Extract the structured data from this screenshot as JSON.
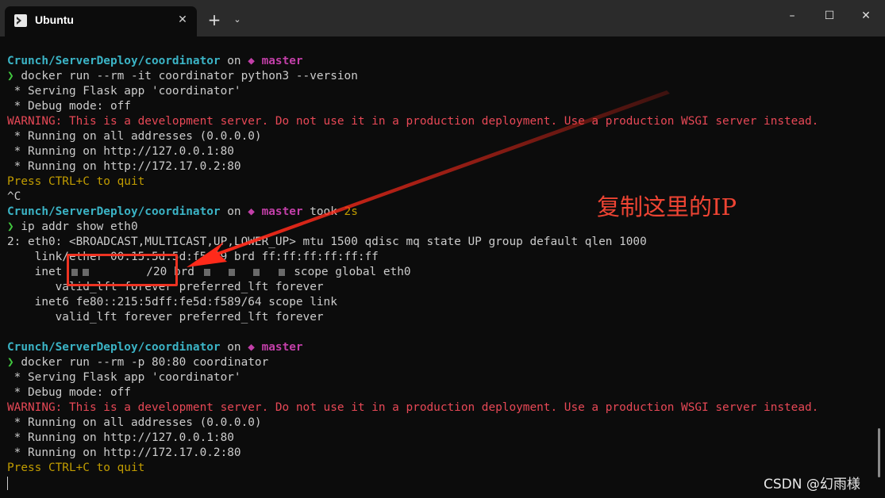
{
  "window": {
    "tab_title": "Ubuntu",
    "tab_close": "✕",
    "new_tab": "+",
    "tab_dropdown": "⌄",
    "minimize": "–",
    "maximize": "☐",
    "close": "✕"
  },
  "terminal": {
    "lines": [
      [
        {
          "t": "Crunch/ServerDeploy/coordinator",
          "c": "cyan"
        },
        {
          "t": " on ",
          "c": "white"
        },
        {
          "t": "◆ master",
          "c": "magenta"
        }
      ],
      [
        {
          "t": "❯ ",
          "c": "green"
        },
        {
          "t": "docker run --rm -it coordinator python3 --version",
          "c": "white"
        }
      ],
      [
        {
          "t": " * Serving Flask app 'coordinator'",
          "c": "white"
        }
      ],
      [
        {
          "t": " * Debug mode: off",
          "c": "white"
        }
      ],
      [
        {
          "t": "WARNING: This is a development server. Do not use it in a production deployment. Use a production WSGI server instead.",
          "c": "red"
        }
      ],
      [
        {
          "t": " * Running on all addresses (0.0.0.0)",
          "c": "white"
        }
      ],
      [
        {
          "t": " * Running on http://127.0.0.1:80",
          "c": "white"
        }
      ],
      [
        {
          "t": " * Running on http://172.17.0.2:80",
          "c": "white"
        }
      ],
      [
        {
          "t": "Press CTRL+C to quit",
          "c": "yellow"
        }
      ],
      [
        {
          "t": "^C",
          "c": "white"
        }
      ],
      [
        {
          "t": "Crunch/ServerDeploy/coordinator",
          "c": "cyan"
        },
        {
          "t": " on ",
          "c": "white"
        },
        {
          "t": "◆ master",
          "c": "magenta"
        },
        {
          "t": " took ",
          "c": "white"
        },
        {
          "t": "2s",
          "c": "yellow"
        }
      ],
      [
        {
          "t": "❯ ",
          "c": "green"
        },
        {
          "t": "ip addr show eth0",
          "c": "white"
        }
      ],
      [
        {
          "t": "2: eth0: <BROADCAST,MULTICAST,UP,LOWER_UP> mtu 1500 qdisc mq state UP group default qlen 1000",
          "c": "white"
        }
      ],
      [
        {
          "t": "    link/ether 00:15:5d:5d:f5:89 brd ff:ff:ff:ff:ff:ff",
          "c": "white"
        }
      ],
      [
        {
          "t": "    inet ",
          "c": "white"
        },
        {
          "t": "",
          "c": "redact"
        },
        {
          "t": "",
          "c": "redact"
        },
        {
          "t": "        ",
          "c": "white"
        },
        {
          "t": "/20 brd ",
          "c": "white"
        },
        {
          "t": "",
          "c": "redact"
        },
        {
          "t": "  ",
          "c": "white"
        },
        {
          "t": "",
          "c": "redact"
        },
        {
          "t": "  ",
          "c": "white"
        },
        {
          "t": "",
          "c": "redact"
        },
        {
          "t": "  ",
          "c": "white"
        },
        {
          "t": "",
          "c": "redact"
        },
        {
          "t": " scope global eth0",
          "c": "white"
        }
      ],
      [
        {
          "t": "       valid_lft forever preferred_lft forever",
          "c": "white"
        }
      ],
      [
        {
          "t": "    inet6 fe80::215:5dff:fe5d:f589/64 scope link",
          "c": "white"
        }
      ],
      [
        {
          "t": "       valid_lft forever preferred_lft forever",
          "c": "white"
        }
      ],
      [],
      [
        {
          "t": "Crunch/ServerDeploy/coordinator",
          "c": "cyan"
        },
        {
          "t": " on ",
          "c": "white"
        },
        {
          "t": "◆ master",
          "c": "magenta"
        }
      ],
      [
        {
          "t": "❯ ",
          "c": "green"
        },
        {
          "t": "docker run --rm -p 80:80 coordinator",
          "c": "white"
        }
      ],
      [
        {
          "t": " * Serving Flask app 'coordinator'",
          "c": "white"
        }
      ],
      [
        {
          "t": " * Debug mode: off",
          "c": "white"
        }
      ],
      [
        {
          "t": "WARNING: This is a development server. Do not use it in a production deployment. Use a production WSGI server instead.",
          "c": "red"
        }
      ],
      [
        {
          "t": " * Running on all addresses (0.0.0.0)",
          "c": "white"
        }
      ],
      [
        {
          "t": " * Running on http://127.0.0.1:80",
          "c": "white"
        }
      ],
      [
        {
          "t": " * Running on http://172.17.0.2:80",
          "c": "white"
        }
      ],
      [
        {
          "t": "Press CTRL+C to quit",
          "c": "yellow"
        }
      ]
    ]
  },
  "annotation": {
    "text": "复制这里的IP",
    "color": "#ee4433"
  },
  "watermark": "CSDN @幻雨様"
}
